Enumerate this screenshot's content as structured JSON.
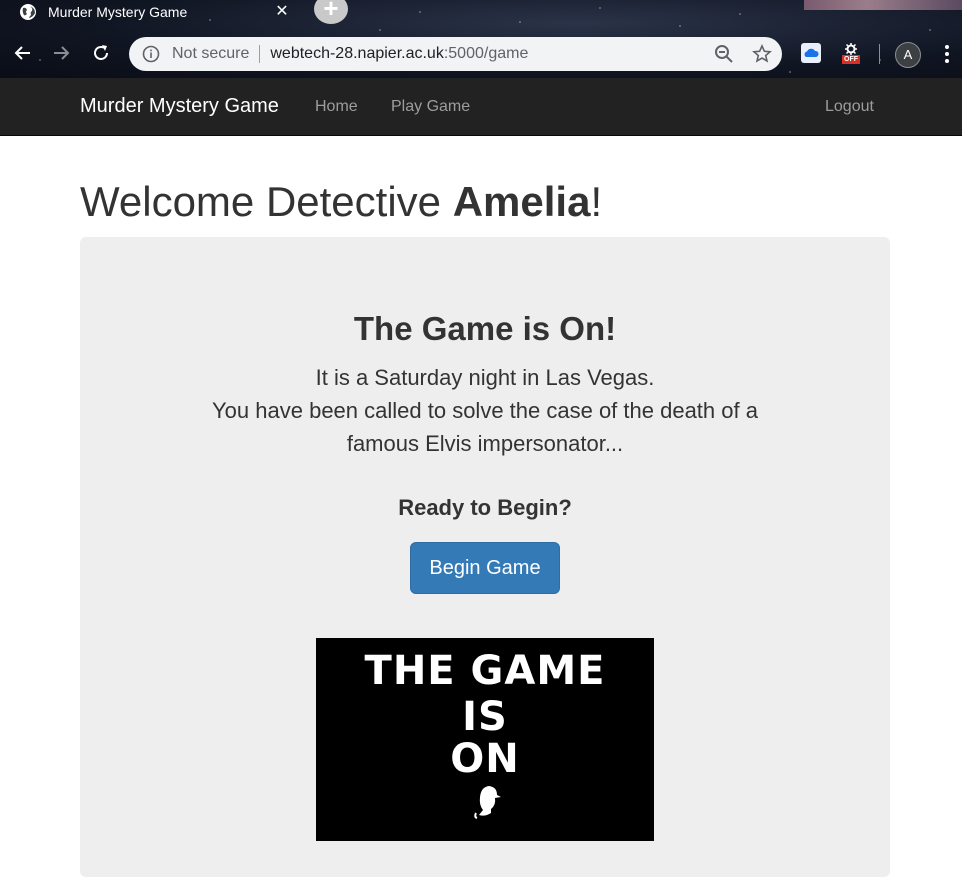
{
  "browser": {
    "tab_title": "Murder Mystery Game",
    "omnibox": {
      "security_label": "Not secure",
      "url_host": "webtech-28.napier.ac.uk",
      "url_path": ":5000/game"
    },
    "profile_initial": "A",
    "extension_badge": "OFF"
  },
  "navbar": {
    "brand": "Murder Mystery Game",
    "links": [
      "Home",
      "Play Game"
    ],
    "logout": "Logout"
  },
  "page": {
    "welcome_prefix": "Welcome Detective ",
    "user_name": "Amelia",
    "welcome_suffix": "!",
    "game_title": "The Game is On!",
    "intro_line1": "It is a Saturday night in Las Vegas.",
    "intro_line2": "You have been called to solve the case of the death of a famous Elvis impersonator...",
    "ready_text": "Ready to Begin?",
    "begin_button": "Begin Game",
    "poster": {
      "line1": "THE GAME",
      "line2": "IS",
      "line3": "ON"
    }
  },
  "colors": {
    "navbar_bg": "#222222",
    "jumbotron_bg": "#eeeeee",
    "primary_button": "#337ab7"
  }
}
